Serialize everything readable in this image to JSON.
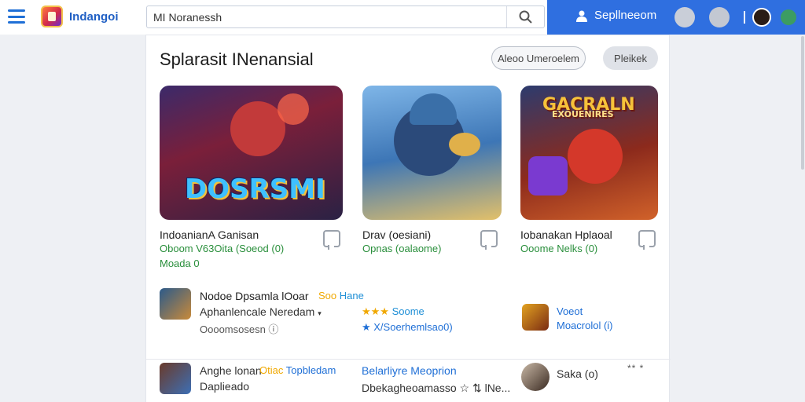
{
  "header": {
    "app_name": "Indangoi",
    "search_value": "MI Noranessh",
    "signin_label": "Sepllneeom"
  },
  "page": {
    "title": "Splarasit  INenansial",
    "btn_outline": "Aleoo Umeroelem",
    "btn_fill": "Pleikek"
  },
  "games": [
    {
      "thumb_text": "DOSRSMI",
      "title": "IndoanianA Ganisan",
      "subtitle": "Oboom V63Oita (Soeod (0)",
      "subtitle2": "Moada 0"
    },
    {
      "thumb_text": "",
      "title": "Drav (oesiani)",
      "subtitle": "Opnas (oalaome)",
      "subtitle2": ""
    },
    {
      "thumb_text": "GACRALN",
      "thumb_text2": "EXOUENIRES",
      "title": "Iobanakan Hplaoal",
      "subtitle": "Ooome Nelks (0)",
      "subtitle2": ""
    }
  ],
  "list": {
    "row1": {
      "title": "Nodoe Dpsamla lOoar",
      "tag_a": "Soo",
      "tag_b": "Hane",
      "subtitle": "Aphanlencale Neredam",
      "meta": "Oooomsosesn ⓘ",
      "stars": "★★★",
      "stars_label": "Soome",
      "category": "★ X/Soerhemlsao0)",
      "right_title": "Voeot",
      "right_sub": "Moacrolol (i)"
    },
    "row2": {
      "title": "Anghe lonan",
      "tag_a": "Otiac",
      "tag_b": "Topbledam",
      "subtitle": "Daplieado",
      "category": "Belarliyre Meoprion",
      "meta": "Dbekagheoamasso ☆ ⇅ lNe...",
      "name": "Saka (o)",
      "stars": "** *"
    }
  }
}
